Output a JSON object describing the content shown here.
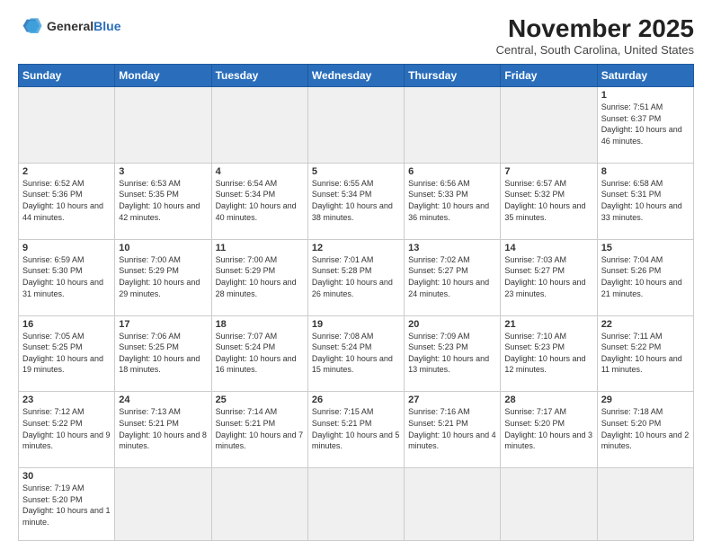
{
  "header": {
    "logo_general": "General",
    "logo_blue": "Blue",
    "month_title": "November 2025",
    "location": "Central, South Carolina, United States"
  },
  "days_of_week": [
    "Sunday",
    "Monday",
    "Tuesday",
    "Wednesday",
    "Thursday",
    "Friday",
    "Saturday"
  ],
  "weeks": [
    [
      {
        "day": "",
        "info": ""
      },
      {
        "day": "",
        "info": ""
      },
      {
        "day": "",
        "info": ""
      },
      {
        "day": "",
        "info": ""
      },
      {
        "day": "",
        "info": ""
      },
      {
        "day": "",
        "info": ""
      },
      {
        "day": "1",
        "info": "Sunrise: 7:51 AM\nSunset: 6:37 PM\nDaylight: 10 hours and 46 minutes."
      }
    ],
    [
      {
        "day": "2",
        "info": "Sunrise: 6:52 AM\nSunset: 5:36 PM\nDaylight: 10 hours and 44 minutes."
      },
      {
        "day": "3",
        "info": "Sunrise: 6:53 AM\nSunset: 5:35 PM\nDaylight: 10 hours and 42 minutes."
      },
      {
        "day": "4",
        "info": "Sunrise: 6:54 AM\nSunset: 5:34 PM\nDaylight: 10 hours and 40 minutes."
      },
      {
        "day": "5",
        "info": "Sunrise: 6:55 AM\nSunset: 5:34 PM\nDaylight: 10 hours and 38 minutes."
      },
      {
        "day": "6",
        "info": "Sunrise: 6:56 AM\nSunset: 5:33 PM\nDaylight: 10 hours and 36 minutes."
      },
      {
        "day": "7",
        "info": "Sunrise: 6:57 AM\nSunset: 5:32 PM\nDaylight: 10 hours and 35 minutes."
      },
      {
        "day": "8",
        "info": "Sunrise: 6:58 AM\nSunset: 5:31 PM\nDaylight: 10 hours and 33 minutes."
      }
    ],
    [
      {
        "day": "9",
        "info": "Sunrise: 6:59 AM\nSunset: 5:30 PM\nDaylight: 10 hours and 31 minutes."
      },
      {
        "day": "10",
        "info": "Sunrise: 7:00 AM\nSunset: 5:29 PM\nDaylight: 10 hours and 29 minutes."
      },
      {
        "day": "11",
        "info": "Sunrise: 7:00 AM\nSunset: 5:29 PM\nDaylight: 10 hours and 28 minutes."
      },
      {
        "day": "12",
        "info": "Sunrise: 7:01 AM\nSunset: 5:28 PM\nDaylight: 10 hours and 26 minutes."
      },
      {
        "day": "13",
        "info": "Sunrise: 7:02 AM\nSunset: 5:27 PM\nDaylight: 10 hours and 24 minutes."
      },
      {
        "day": "14",
        "info": "Sunrise: 7:03 AM\nSunset: 5:27 PM\nDaylight: 10 hours and 23 minutes."
      },
      {
        "day": "15",
        "info": "Sunrise: 7:04 AM\nSunset: 5:26 PM\nDaylight: 10 hours and 21 minutes."
      }
    ],
    [
      {
        "day": "16",
        "info": "Sunrise: 7:05 AM\nSunset: 5:25 PM\nDaylight: 10 hours and 19 minutes."
      },
      {
        "day": "17",
        "info": "Sunrise: 7:06 AM\nSunset: 5:25 PM\nDaylight: 10 hours and 18 minutes."
      },
      {
        "day": "18",
        "info": "Sunrise: 7:07 AM\nSunset: 5:24 PM\nDaylight: 10 hours and 16 minutes."
      },
      {
        "day": "19",
        "info": "Sunrise: 7:08 AM\nSunset: 5:24 PM\nDaylight: 10 hours and 15 minutes."
      },
      {
        "day": "20",
        "info": "Sunrise: 7:09 AM\nSunset: 5:23 PM\nDaylight: 10 hours and 13 minutes."
      },
      {
        "day": "21",
        "info": "Sunrise: 7:10 AM\nSunset: 5:23 PM\nDaylight: 10 hours and 12 minutes."
      },
      {
        "day": "22",
        "info": "Sunrise: 7:11 AM\nSunset: 5:22 PM\nDaylight: 10 hours and 11 minutes."
      }
    ],
    [
      {
        "day": "23",
        "info": "Sunrise: 7:12 AM\nSunset: 5:22 PM\nDaylight: 10 hours and 9 minutes."
      },
      {
        "day": "24",
        "info": "Sunrise: 7:13 AM\nSunset: 5:21 PM\nDaylight: 10 hours and 8 minutes."
      },
      {
        "day": "25",
        "info": "Sunrise: 7:14 AM\nSunset: 5:21 PM\nDaylight: 10 hours and 7 minutes."
      },
      {
        "day": "26",
        "info": "Sunrise: 7:15 AM\nSunset: 5:21 PM\nDaylight: 10 hours and 5 minutes."
      },
      {
        "day": "27",
        "info": "Sunrise: 7:16 AM\nSunset: 5:21 PM\nDaylight: 10 hours and 4 minutes."
      },
      {
        "day": "28",
        "info": "Sunrise: 7:17 AM\nSunset: 5:20 PM\nDaylight: 10 hours and 3 minutes."
      },
      {
        "day": "29",
        "info": "Sunrise: 7:18 AM\nSunset: 5:20 PM\nDaylight: 10 hours and 2 minutes."
      }
    ],
    [
      {
        "day": "30",
        "info": "Sunrise: 7:19 AM\nSunset: 5:20 PM\nDaylight: 10 hours and 1 minute."
      },
      {
        "day": "",
        "info": ""
      },
      {
        "day": "",
        "info": ""
      },
      {
        "day": "",
        "info": ""
      },
      {
        "day": "",
        "info": ""
      },
      {
        "day": "",
        "info": ""
      },
      {
        "day": "",
        "info": ""
      }
    ]
  ]
}
